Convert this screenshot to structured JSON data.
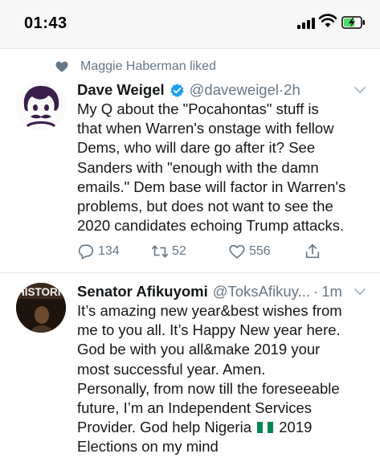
{
  "status_bar": {
    "time": "01:43"
  },
  "tweet1": {
    "social_context": "Maggie Haberman liked",
    "author_name": "Dave Weigel",
    "handle": "@daveweigel",
    "separator": "·",
    "time": "2h",
    "text_lines": [
      "My Q about the \"Pocahontas\" stuff is",
      "that when Warren's onstage with fellow",
      "Dems, who will dare go after it? See",
      "Sanders with \"enough with the damn",
      "emails.\" Dem base will factor in Warren's",
      "problems, but does not want to see the",
      "2020 candidates echoing Trump attacks."
    ],
    "reply_count": "134",
    "retweet_count": "52",
    "like_count": "556"
  },
  "tweet2": {
    "avatar_text": "HISTORIC",
    "author_name": "Senator Afikuyomi",
    "handle": "@ToksAfikuy...",
    "separator": "·",
    "time": "1m",
    "text_lines": [
      "It’s amazing new year&best wishes from",
      "me to you all. It’s Happy New year here.",
      "God be with you all&make 2019 your",
      "most successful year. Amen.",
      "Personally, from now till the foreseeable",
      "future, I’m  an Independent Services",
      "Provider. God help Nigeria"
    ],
    "line7_after_flag": " 2019",
    "text_line8": "Elections on my mind"
  },
  "colors": {
    "text": "#14171a",
    "muted": "#657786",
    "verified_blue": "#1da1f2",
    "divider": "#e1e8ed",
    "nigeria_green": "#008751"
  },
  "icons": [
    "heart-icon",
    "verified-badge-icon",
    "chevron-down-icon",
    "reply-icon",
    "retweet-icon",
    "like-icon",
    "share-icon",
    "signal-icon",
    "wifi-icon",
    "battery-charging-icon",
    "nigeria-flag-icon"
  ]
}
